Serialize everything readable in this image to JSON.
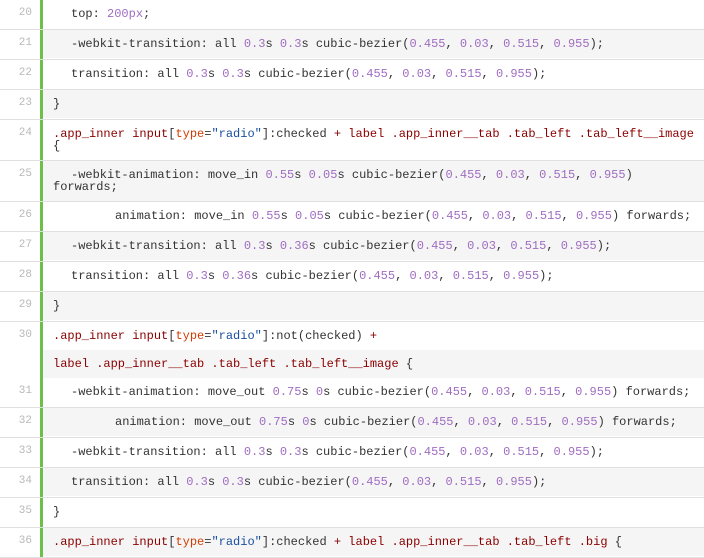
{
  "lines": [
    {
      "num": "20",
      "segments": [
        {
          "cls": "indent1 tk-prop",
          "t": "top: "
        },
        {
          "cls": "tk-num",
          "t": "200"
        },
        {
          "cls": "tk-unit",
          "t": "px"
        },
        {
          "cls": "tk-punc",
          "t": ";"
        }
      ]
    },
    {
      "num": "21",
      "segments": [
        {
          "cls": "indent1 tk-prop",
          "t": "-webkit-transition: all "
        },
        {
          "cls": "tk-num",
          "t": "0.3"
        },
        {
          "cls": "tk-val",
          "t": "s "
        },
        {
          "cls": "tk-num",
          "t": "0.3"
        },
        {
          "cls": "tk-val",
          "t": "s cubic-bezier("
        },
        {
          "cls": "tk-num",
          "t": "0.455"
        },
        {
          "cls": "tk-val",
          "t": ", "
        },
        {
          "cls": "tk-num",
          "t": "0.03"
        },
        {
          "cls": "tk-val",
          "t": ", "
        },
        {
          "cls": "tk-num",
          "t": "0.515"
        },
        {
          "cls": "tk-val",
          "t": ", "
        },
        {
          "cls": "tk-num",
          "t": "0.955"
        },
        {
          "cls": "tk-val",
          "t": ");"
        }
      ]
    },
    {
      "num": "22",
      "segments": [
        {
          "cls": "indent1 tk-prop",
          "t": "transition: all "
        },
        {
          "cls": "tk-num",
          "t": "0.3"
        },
        {
          "cls": "tk-val",
          "t": "s "
        },
        {
          "cls": "tk-num",
          "t": "0.3"
        },
        {
          "cls": "tk-val",
          "t": "s cubic-bezier("
        },
        {
          "cls": "tk-num",
          "t": "0.455"
        },
        {
          "cls": "tk-val",
          "t": ", "
        },
        {
          "cls": "tk-num",
          "t": "0.03"
        },
        {
          "cls": "tk-val",
          "t": ", "
        },
        {
          "cls": "tk-num",
          "t": "0.515"
        },
        {
          "cls": "tk-val",
          "t": ", "
        },
        {
          "cls": "tk-num",
          "t": "0.955"
        },
        {
          "cls": "tk-val",
          "t": ");"
        }
      ]
    },
    {
      "num": "23",
      "segments": [
        {
          "cls": "tk-punc",
          "t": "}"
        }
      ]
    },
    {
      "num": "24",
      "segments": [
        {
          "cls": "tk-sel",
          "t": ".app_inner "
        },
        {
          "cls": "tk-sel",
          "t": "input"
        },
        {
          "cls": "tk-punc",
          "t": "["
        },
        {
          "cls": "tk-attr",
          "t": "type"
        },
        {
          "cls": "tk-punc",
          "t": "="
        },
        {
          "cls": "tk-str",
          "t": "\"radio\""
        },
        {
          "cls": "tk-punc",
          "t": "]"
        },
        {
          "cls": "tk-pseudo",
          "t": ":checked"
        },
        {
          "cls": "tk-sel",
          "t": " + label .app_inner__tab .tab_left .tab_left__image "
        },
        {
          "cls": "tk-punc",
          "t": "{"
        }
      ]
    },
    {
      "num": "25",
      "segments": [
        {
          "cls": "indent1 tk-prop",
          "t": "-webkit-animation: move_in "
        },
        {
          "cls": "tk-num",
          "t": "0.55"
        },
        {
          "cls": "tk-val",
          "t": "s "
        },
        {
          "cls": "tk-num",
          "t": "0.05"
        },
        {
          "cls": "tk-val",
          "t": "s cubic-bezier("
        },
        {
          "cls": "tk-num",
          "t": "0.455"
        },
        {
          "cls": "tk-val",
          "t": ", "
        },
        {
          "cls": "tk-num",
          "t": "0.03"
        },
        {
          "cls": "tk-val",
          "t": ", "
        },
        {
          "cls": "tk-num",
          "t": "0.515"
        },
        {
          "cls": "tk-val",
          "t": ", "
        },
        {
          "cls": "tk-num",
          "t": "0.955"
        },
        {
          "cls": "tk-val",
          "t": ") forwards;"
        }
      ]
    },
    {
      "num": "26",
      "segments": [
        {
          "cls": "indent2 tk-prop",
          "t": "animation: move_in "
        },
        {
          "cls": "tk-num",
          "t": "0.55"
        },
        {
          "cls": "tk-val",
          "t": "s "
        },
        {
          "cls": "tk-num",
          "t": "0.05"
        },
        {
          "cls": "tk-val",
          "t": "s cubic-bezier("
        },
        {
          "cls": "tk-num",
          "t": "0.455"
        },
        {
          "cls": "tk-val",
          "t": ", "
        },
        {
          "cls": "tk-num",
          "t": "0.03"
        },
        {
          "cls": "tk-val",
          "t": ", "
        },
        {
          "cls": "tk-num",
          "t": "0.515"
        },
        {
          "cls": "tk-val",
          "t": ", "
        },
        {
          "cls": "tk-num",
          "t": "0.955"
        },
        {
          "cls": "tk-val",
          "t": ") forwards;"
        }
      ]
    },
    {
      "num": "27",
      "segments": [
        {
          "cls": "indent1 tk-prop",
          "t": "-webkit-transition: all "
        },
        {
          "cls": "tk-num",
          "t": "0.3"
        },
        {
          "cls": "tk-val",
          "t": "s "
        },
        {
          "cls": "tk-num",
          "t": "0.36"
        },
        {
          "cls": "tk-val",
          "t": "s cubic-bezier("
        },
        {
          "cls": "tk-num",
          "t": "0.455"
        },
        {
          "cls": "tk-val",
          "t": ", "
        },
        {
          "cls": "tk-num",
          "t": "0.03"
        },
        {
          "cls": "tk-val",
          "t": ", "
        },
        {
          "cls": "tk-num",
          "t": "0.515"
        },
        {
          "cls": "tk-val",
          "t": ", "
        },
        {
          "cls": "tk-num",
          "t": "0.955"
        },
        {
          "cls": "tk-val",
          "t": ");"
        }
      ]
    },
    {
      "num": "28",
      "segments": [
        {
          "cls": "indent1 tk-prop",
          "t": "transition: all "
        },
        {
          "cls": "tk-num",
          "t": "0.3"
        },
        {
          "cls": "tk-val",
          "t": "s "
        },
        {
          "cls": "tk-num",
          "t": "0.36"
        },
        {
          "cls": "tk-val",
          "t": "s cubic-bezier("
        },
        {
          "cls": "tk-num",
          "t": "0.455"
        },
        {
          "cls": "tk-val",
          "t": ", "
        },
        {
          "cls": "tk-num",
          "t": "0.03"
        },
        {
          "cls": "tk-val",
          "t": ", "
        },
        {
          "cls": "tk-num",
          "t": "0.515"
        },
        {
          "cls": "tk-val",
          "t": ", "
        },
        {
          "cls": "tk-num",
          "t": "0.955"
        },
        {
          "cls": "tk-val",
          "t": ");"
        }
      ]
    },
    {
      "num": "29",
      "segments": [
        {
          "cls": "tk-punc",
          "t": "}"
        }
      ]
    },
    {
      "num": "30",
      "noborder": true,
      "segments": [
        {
          "cls": "tk-sel",
          "t": ".app_inner "
        },
        {
          "cls": "tk-sel",
          "t": "input"
        },
        {
          "cls": "tk-punc",
          "t": "["
        },
        {
          "cls": "tk-attr",
          "t": "type"
        },
        {
          "cls": "tk-punc",
          "t": "="
        },
        {
          "cls": "tk-str",
          "t": "\"radio\""
        },
        {
          "cls": "tk-punc",
          "t": "]"
        },
        {
          "cls": "tk-pseudo",
          "t": ":not(checked)"
        },
        {
          "cls": "tk-sel",
          "t": " +"
        }
      ]
    },
    {
      "num": "",
      "noborder": true,
      "segments": [
        {
          "cls": "tk-sel",
          "t": "label .app_inner__tab .tab_left .tab_left__image "
        },
        {
          "cls": "tk-punc",
          "t": "{"
        }
      ]
    },
    {
      "num": "31",
      "segments": [
        {
          "cls": "indent1 tk-prop",
          "t": "-webkit-animation: move_out "
        },
        {
          "cls": "tk-num",
          "t": "0.75"
        },
        {
          "cls": "tk-val",
          "t": "s "
        },
        {
          "cls": "tk-num",
          "t": "0"
        },
        {
          "cls": "tk-val",
          "t": "s cubic-bezier("
        },
        {
          "cls": "tk-num",
          "t": "0.455"
        },
        {
          "cls": "tk-val",
          "t": ", "
        },
        {
          "cls": "tk-num",
          "t": "0.03"
        },
        {
          "cls": "tk-val",
          "t": ", "
        },
        {
          "cls": "tk-num",
          "t": "0.515"
        },
        {
          "cls": "tk-val",
          "t": ", "
        },
        {
          "cls": "tk-num",
          "t": "0.955"
        },
        {
          "cls": "tk-val",
          "t": ") forwards;"
        }
      ]
    },
    {
      "num": "32",
      "segments": [
        {
          "cls": "indent2 tk-prop",
          "t": "animation: move_out "
        },
        {
          "cls": "tk-num",
          "t": "0.75"
        },
        {
          "cls": "tk-val",
          "t": "s "
        },
        {
          "cls": "tk-num",
          "t": "0"
        },
        {
          "cls": "tk-val",
          "t": "s cubic-bezier("
        },
        {
          "cls": "tk-num",
          "t": "0.455"
        },
        {
          "cls": "tk-val",
          "t": ", "
        },
        {
          "cls": "tk-num",
          "t": "0.03"
        },
        {
          "cls": "tk-val",
          "t": ", "
        },
        {
          "cls": "tk-num",
          "t": "0.515"
        },
        {
          "cls": "tk-val",
          "t": ", "
        },
        {
          "cls": "tk-num",
          "t": "0.955"
        },
        {
          "cls": "tk-val",
          "t": ") forwards;"
        }
      ]
    },
    {
      "num": "33",
      "segments": [
        {
          "cls": "indent1 tk-prop",
          "t": "-webkit-transition: all "
        },
        {
          "cls": "tk-num",
          "t": "0.3"
        },
        {
          "cls": "tk-val",
          "t": "s "
        },
        {
          "cls": "tk-num",
          "t": "0.3"
        },
        {
          "cls": "tk-val",
          "t": "s cubic-bezier("
        },
        {
          "cls": "tk-num",
          "t": "0.455"
        },
        {
          "cls": "tk-val",
          "t": ", "
        },
        {
          "cls": "tk-num",
          "t": "0.03"
        },
        {
          "cls": "tk-val",
          "t": ", "
        },
        {
          "cls": "tk-num",
          "t": "0.515"
        },
        {
          "cls": "tk-val",
          "t": ", "
        },
        {
          "cls": "tk-num",
          "t": "0.955"
        },
        {
          "cls": "tk-val",
          "t": ");"
        }
      ]
    },
    {
      "num": "34",
      "segments": [
        {
          "cls": "indent1 tk-prop",
          "t": "transition: all "
        },
        {
          "cls": "tk-num",
          "t": "0.3"
        },
        {
          "cls": "tk-val",
          "t": "s "
        },
        {
          "cls": "tk-num",
          "t": "0.3"
        },
        {
          "cls": "tk-val",
          "t": "s cubic-bezier("
        },
        {
          "cls": "tk-num",
          "t": "0.455"
        },
        {
          "cls": "tk-val",
          "t": ", "
        },
        {
          "cls": "tk-num",
          "t": "0.03"
        },
        {
          "cls": "tk-val",
          "t": ", "
        },
        {
          "cls": "tk-num",
          "t": "0.515"
        },
        {
          "cls": "tk-val",
          "t": ", "
        },
        {
          "cls": "tk-num",
          "t": "0.955"
        },
        {
          "cls": "tk-val",
          "t": ");"
        }
      ]
    },
    {
      "num": "35",
      "segments": [
        {
          "cls": "tk-punc",
          "t": "}"
        }
      ]
    },
    {
      "num": "36",
      "segments": [
        {
          "cls": "tk-sel",
          "t": ".app_inner "
        },
        {
          "cls": "tk-sel",
          "t": "input"
        },
        {
          "cls": "tk-punc",
          "t": "["
        },
        {
          "cls": "tk-attr",
          "t": "type"
        },
        {
          "cls": "tk-punc",
          "t": "="
        },
        {
          "cls": "tk-str",
          "t": "\"radio\""
        },
        {
          "cls": "tk-punc",
          "t": "]"
        },
        {
          "cls": "tk-pseudo",
          "t": ":checked"
        },
        {
          "cls": "tk-sel",
          "t": " + label .app_inner__tab .tab_left .big "
        },
        {
          "cls": "tk-punc",
          "t": "{"
        }
      ]
    }
  ]
}
